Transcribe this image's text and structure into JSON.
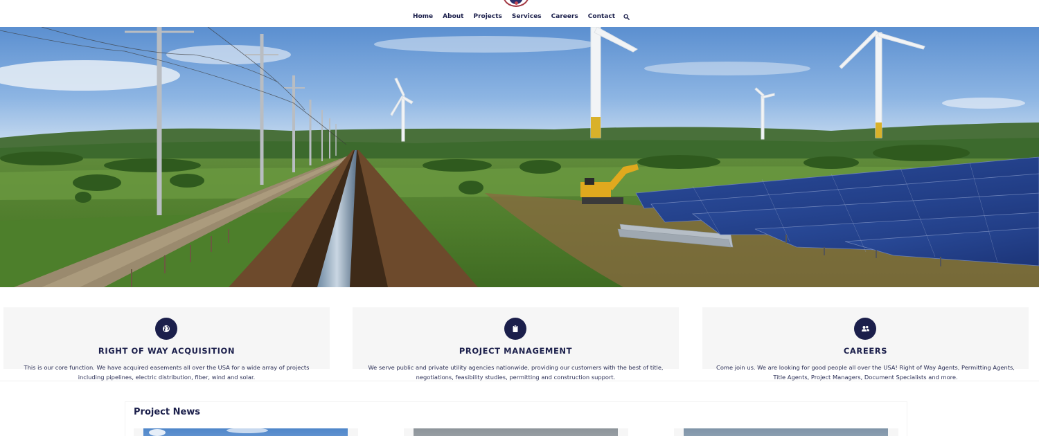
{
  "header": {
    "nav": [
      {
        "label": "Home"
      },
      {
        "label": "About"
      },
      {
        "label": "Projects"
      },
      {
        "label": "Services"
      },
      {
        "label": "Careers"
      },
      {
        "label": "Contact"
      }
    ],
    "search_icon": "search-icon"
  },
  "hero": {
    "image": "landscape with power lines, pipeline trench, wind turbines, excavator and solar panels"
  },
  "features": [
    {
      "icon": "globe-icon",
      "title": "RIGHT OF WAY ACQUISITION",
      "line1": "This is our core function. We have acquired easements all over the USA for a wide array of projects",
      "line2": "including pipelines, electric distribution, fiber, wind and solar."
    },
    {
      "icon": "clipboard-icon",
      "title": "PROJECT MANAGEMENT",
      "line1": "We serve public and private utility agencies nationwide, providing our customers with the best of title,",
      "line2": "negotiations, feasibility studies, permitting and construction support."
    },
    {
      "icon": "users-icon",
      "title": "CAREERS",
      "line1": "Come join us. We are looking for good people all over the USA! Right of Way Agents, Permitting Agents,",
      "line2": "Title Agents, Project Managers, Document Specialists and more."
    }
  ],
  "news": {
    "title": "Project News"
  },
  "colors": {
    "brand_navy": "#1b1f4b",
    "card_bg": "#f6f6f6",
    "logo_red": "#a33a45"
  }
}
